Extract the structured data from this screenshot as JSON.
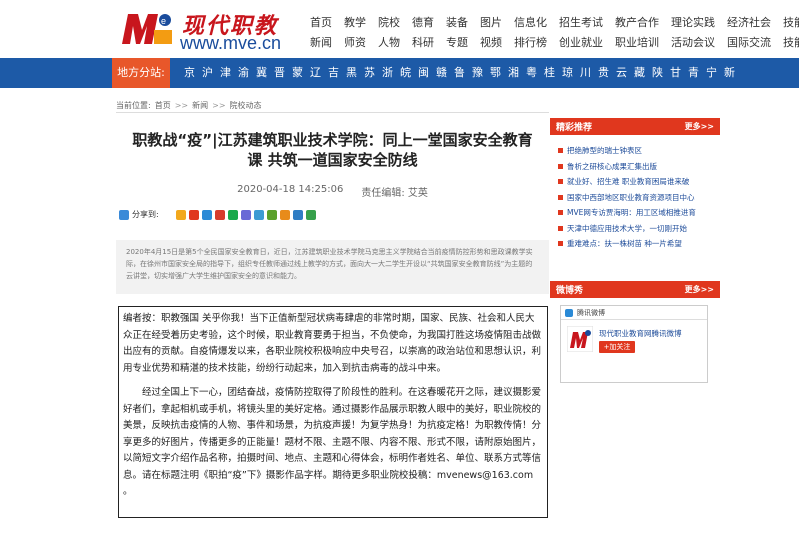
{
  "header": {
    "logo_cn": "现代职教",
    "logo_url": "www.mve.cn",
    "nav_row1": [
      "首页",
      "教学",
      "院校",
      "德育",
      "装备",
      "图片",
      "信息化",
      "招生考试",
      "教产合作",
      "理论实践",
      "经济社会",
      "技能大赛"
    ],
    "nav_row2": [
      "新闻",
      "师资",
      "人物",
      "科研",
      "专题",
      "视频",
      "排行榜",
      "创业就业",
      "职业培训",
      "活动会议",
      "国际交流",
      "技能作品"
    ]
  },
  "region": {
    "label": "地方分站:",
    "items": [
      "京",
      "沪",
      "津",
      "渝",
      "冀",
      "晋",
      "蒙",
      "辽",
      "吉",
      "黑",
      "苏",
      "浙",
      "皖",
      "闽",
      "赣",
      "鲁",
      "豫",
      "鄂",
      "湘",
      "粤",
      "桂",
      "琼",
      "川",
      "贵",
      "云",
      "藏",
      "陕",
      "甘",
      "青",
      "宁",
      "新"
    ]
  },
  "breadcrumb": {
    "prefix": "当前位置:",
    "items": [
      "首页",
      "新闻",
      "院校动态"
    ],
    "sep": ">>"
  },
  "article": {
    "title": "职教战“疫”|江苏建筑职业技术学院：同上一堂国家安全教育课 共筑一道国家安全防线",
    "date": "2020-04-18 14:25:06",
    "editor": "责任编辑:  艾英",
    "share_label": "分享到:",
    "summary": "2020年4月15日是第5个全民国家安全教育日，近日，江苏建筑职业技术学院马克思主义学院结合当前疫情防控形势和思政课教学实际，在徐州市国家安全局的指导下，组织专任教师通过线上教学的方式，面向大一大二学生开设以“共筑国家安全教育防线”为主题的云讲堂，切实增强广大学生维护国家安全的意识和能力。",
    "editor_note_p1": "编者按：职教强国 关乎你我！当下正值新型冠状病毒肆虐的非常时期，国家、民族、社会和人民大众正在经受着历史考验，这个时候，职业教育要勇于担当，不负使命，为我国打胜这场疫情阻击战做出应有的贡献。自疫情爆发以来，各职业院校积极响应中央号召，以崇高的政治站位和思想认识，利用专业优势和精湛的技术技能，纷纷行动起来，加入到抗击病毒的战斗中来。",
    "editor_note_p2": "经过全国上下一心，团结奋战，疫情防控取得了阶段性的胜利。在这春暖花开之际，建议摄影爱好者们，拿起相机或手机，将镜头里的美好定格。通过摄影作品展示职教人眼中的美好，职业院校的美景，反映抗击疫情的人物、事件和场景，为抗疫声援！为复学热身！为抗疫定格！为职教传情！分享更多的好图片，传播更多的正能量！题材不限、主题不限、内容不限、形式不限，请附原始图片，以简短文字介绍作品名称，拍摄时间、地点、主题和心得体会，标明作者姓名、单位、联系方式等信息。请在标题注明《职拍“疫”下》摄影作品字样。期待更多职业院校投稿：mvenews@163.com 。"
  },
  "sidebar": {
    "rec_title": "精彩推荐",
    "more": "更多>>",
    "rec_items": [
      "把绝肺型的瑞士钟表区",
      "鲁析之研核心成果汇集出版",
      "就业好、招生难 职业教育困局谁来破",
      "国家中西部地区职业教育资源项目中心",
      "MVE网专访贾海明：用工区域相推进育",
      "天津中德应用技术大学，一切刚开始",
      "重难难点：扶一株树苗 种一片希望"
    ],
    "weibo_title": "微博秀",
    "weibo_more": "更多>>",
    "weibo_bar": "腾讯微博",
    "weibo_name": "现代职业教育网腾讯微博",
    "weibo_follow": "+加关注"
  },
  "colors": {
    "brand_red": "#c8161d",
    "nav_blue": "#1d5aa7",
    "region_orange": "#e8572a",
    "sidebar_red": "#e0371e",
    "link_blue": "#1d4b99"
  }
}
